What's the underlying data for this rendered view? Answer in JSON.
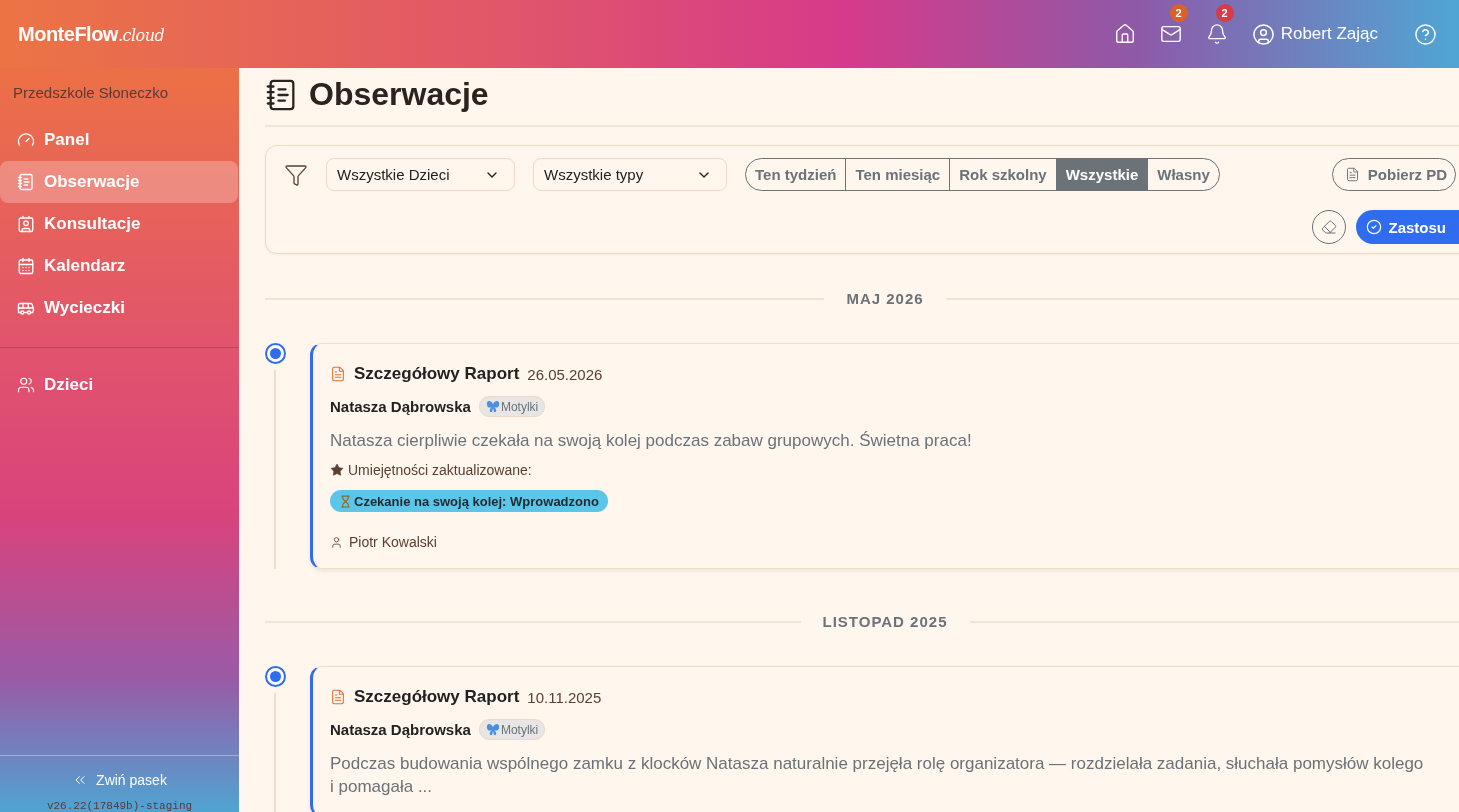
{
  "header": {
    "logo": {
      "name": "MonteFlow",
      "suffix": ".cloud"
    },
    "badges": [
      {
        "count": "2",
        "color": "#d9622b"
      },
      {
        "count": "2",
        "color": "#d63c46"
      }
    ],
    "user": "Robert Zając"
  },
  "sidebar": {
    "school": "Przedszkole Słoneczko",
    "items": [
      {
        "label": "Panel",
        "selected": false
      },
      {
        "label": "Obserwacje",
        "selected": true
      },
      {
        "label": "Konsultacje",
        "selected": false
      },
      {
        "label": "Kalendarz",
        "selected": false
      },
      {
        "label": "Wycieczki",
        "selected": false
      }
    ],
    "secondary_items": [
      {
        "label": "Dzieci",
        "selected": false
      }
    ],
    "collapse": "Zwiń pasek",
    "version": "v26.22(17849b)-staging"
  },
  "page": {
    "title": "Obserwacje"
  },
  "filters": {
    "child_select": "Wszystkie Dzieci",
    "type_select": "Wszystkie typy",
    "periods": [
      {
        "label": "Ten tydzień",
        "selected": false
      },
      {
        "label": "Ten miesiąc",
        "selected": false
      },
      {
        "label": "Rok szkolny",
        "selected": false
      },
      {
        "label": "Wszystkie",
        "selected": true
      },
      {
        "label": "Własny",
        "selected": false
      }
    ],
    "pdf_button": "Pobierz PD",
    "apply_button": "Zastosu"
  },
  "timeline": [
    {
      "month": "MAJ 2026",
      "entries": [
        {
          "type": "Szczegółowy Raport",
          "date": "26.05.2026",
          "child": "Natasza Dąbrowska",
          "group": "Motylki",
          "description": [
            "Natasza cierpliwie czekała na swoją kolej podczas zabaw grupowych. Świetna praca!"
          ],
          "skills_label": "Umiejętności zaktualizowane:",
          "skills": [
            "Czekanie na swoją kolej: Wprowadzono"
          ],
          "author": "Piotr Kowalski"
        }
      ]
    },
    {
      "month": "LISTOPAD 2025",
      "entries": [
        {
          "type": "Szczegółowy Raport",
          "date": "10.11.2025",
          "child": "Natasza Dąbrowska",
          "group": "Motylki",
          "description": [
            "Podczas budowania wspólnego zamku z klocków Natasza naturalnie przejęła rolę organizatora — rozdzielała zadania, słuchała pomysłów kolego",
            "i pomagała ..."
          ]
        }
      ]
    }
  ]
}
